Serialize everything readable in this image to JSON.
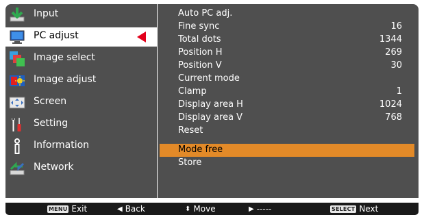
{
  "sidebar": {
    "items": [
      {
        "label": "Input",
        "icon": "input-icon",
        "selected": false
      },
      {
        "label": "PC adjust",
        "icon": "pc-adjust-icon",
        "selected": true
      },
      {
        "label": "Image select",
        "icon": "image-select-icon",
        "selected": false
      },
      {
        "label": "Image adjust",
        "icon": "image-adjust-icon",
        "selected": false
      },
      {
        "label": "Screen",
        "icon": "screen-icon",
        "selected": false
      },
      {
        "label": "Setting",
        "icon": "setting-icon",
        "selected": false
      },
      {
        "label": "Information",
        "icon": "information-icon",
        "selected": false
      },
      {
        "label": "Network",
        "icon": "network-icon",
        "selected": false
      }
    ],
    "selected_arrow_color": "#e3001b"
  },
  "pc_adjust": {
    "rows": [
      {
        "name": "Auto PC adj.",
        "value": ""
      },
      {
        "name": "Fine sync",
        "value": "16"
      },
      {
        "name": "Total dots",
        "value": "1344"
      },
      {
        "name": "Position H",
        "value": "269"
      },
      {
        "name": "Position V",
        "value": "30"
      },
      {
        "name": "Current mode",
        "value": ""
      },
      {
        "name": "Clamp",
        "value": "1"
      },
      {
        "name": "Display area H",
        "value": "1024"
      },
      {
        "name": "Display area V",
        "value": "768"
      },
      {
        "name": "Reset",
        "value": ""
      },
      {
        "name": "Mode free",
        "value": ""
      },
      {
        "name": "Store",
        "value": ""
      }
    ],
    "highlighted_row": "Mode free",
    "highlight_color": "#e38a28"
  },
  "footer": {
    "exit_key": "MENU",
    "exit_label": "Exit",
    "back_glyph": "◀",
    "back_label": "Back",
    "move_glyph": "⬍",
    "move_label": "Move",
    "next_glyph": "▶",
    "next_label": "-----",
    "select_key": "SELECT",
    "select_label": "Next"
  }
}
